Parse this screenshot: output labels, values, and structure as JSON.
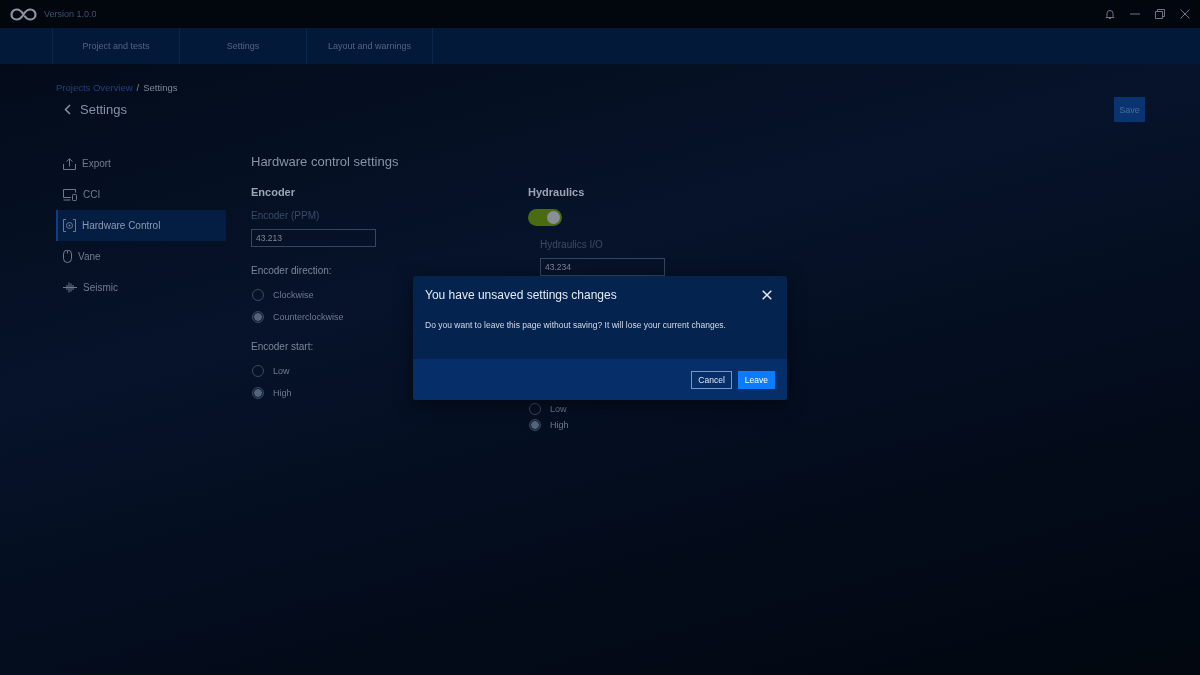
{
  "title_bar": {
    "version": "Version 1.0.0"
  },
  "nav_tabs": [
    {
      "label": "Project and tests",
      "selected": false
    },
    {
      "label": "Settings",
      "selected": false
    },
    {
      "label": "Layout and warnings",
      "selected": false
    }
  ],
  "breadcrumb": {
    "items": [
      {
        "label": "Projects Overview",
        "kind": "link"
      },
      {
        "label": "Settings",
        "kind": "current"
      }
    ],
    "separator": "/"
  },
  "header": {
    "title": "Settings",
    "save_button": "Save"
  },
  "sidebar": {
    "items": [
      {
        "label": "Export",
        "selected": false
      },
      {
        "label": "CCI",
        "selected": false
      },
      {
        "label": "Hardware Control",
        "selected": true
      },
      {
        "label": "Vane",
        "selected": false
      },
      {
        "label": "Seismic",
        "selected": false
      }
    ]
  },
  "content": {
    "title": "Hardware control settings",
    "sections": [
      {
        "title": "Encoder",
        "items": [
          {
            "kind": "field",
            "label": "Encoder (PPM)",
            "value": "43.213"
          },
          {
            "kind": "radios",
            "label": "Encoder direction:",
            "options": [
              {
                "label": "Clockwise",
                "selected": false
              },
              {
                "label": "Counterclockwise",
                "selected": true
              }
            ]
          },
          {
            "kind": "radios",
            "label": "Encoder start:",
            "options": [
              {
                "label": "Low",
                "selected": false
              },
              {
                "label": "High",
                "selected": true
              }
            ]
          }
        ]
      },
      {
        "title": "Hydraulics",
        "items": [
          {
            "kind": "toggle",
            "on": true
          },
          {
            "kind": "subfield",
            "label": "Hydraulics I/O",
            "value": "43.234"
          },
          {
            "kind": "radios",
            "options": [
              {
                "label": "Low",
                "selected": false
              },
              {
                "label": "High",
                "selected": true
              }
            ]
          }
        ]
      }
    ]
  },
  "dialog": {
    "title": "You have unsaved settings changes",
    "message": "Do you want to leave this page without saving? It will lose your current changes.",
    "buttons": [
      {
        "label": "Cancel",
        "kind": "secondary"
      },
      {
        "label": "Leave",
        "kind": "primary"
      }
    ]
  }
}
